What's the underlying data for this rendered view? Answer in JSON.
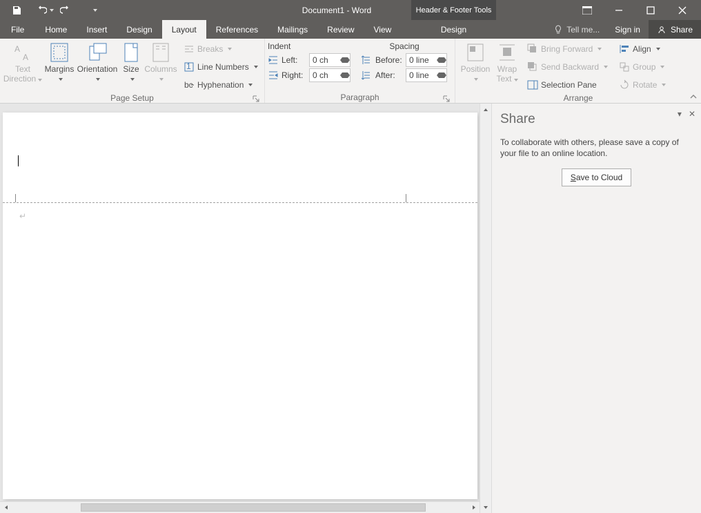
{
  "title": "Document1 - Word",
  "contextual_tool_tab": "Header & Footer Tools",
  "tabs": {
    "file": "File",
    "home": "Home",
    "insert": "Insert",
    "design": "Design",
    "layout": "Layout",
    "references": "References",
    "mailings": "Mailings",
    "review": "Review",
    "view": "View",
    "contextual_design": "Design"
  },
  "tellme_placeholder": "Tell me...",
  "signin": "Sign in",
  "share": "Share",
  "ribbon": {
    "page_setup": {
      "label": "Page Setup",
      "text_direction": "Text\nDirection",
      "margins": "Margins",
      "orientation": "Orientation",
      "size": "Size",
      "columns": "Columns",
      "breaks": "Breaks",
      "line_numbers": "Line Numbers",
      "hyphenation": "Hyphenation"
    },
    "paragraph": {
      "label": "Paragraph",
      "indent_head": "Indent",
      "spacing_head": "Spacing",
      "left": "Left:",
      "right": "Right:",
      "before": "Before:",
      "after": "After:",
      "indent_left_val": "0 ch",
      "indent_right_val": "0 ch",
      "spacing_before_val": "0 line",
      "spacing_after_val": "0 line"
    },
    "arrange": {
      "label": "Arrange",
      "position": "Position",
      "wrap_text": "Wrap\nText",
      "bring_forward": "Bring Forward",
      "send_backward": "Send Backward",
      "selection_pane": "Selection Pane",
      "align": "Align",
      "group": "Group",
      "rotate": "Rotate"
    }
  },
  "share_pane": {
    "title": "Share",
    "message": "To collaborate with others, please save a copy of your file to an online location.",
    "button_prefix": "S",
    "button_rest": "ave to Cloud"
  }
}
